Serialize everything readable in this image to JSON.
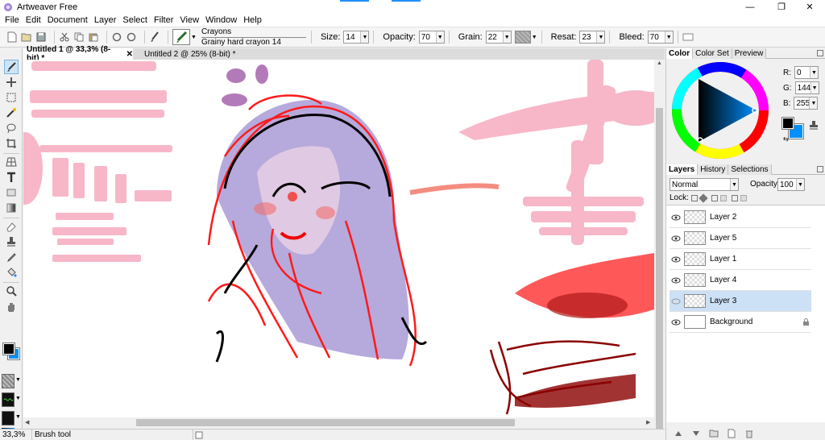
{
  "window": {
    "title": "Artweaver Free",
    "minimize": "—",
    "restore": "❐",
    "close": "✕"
  },
  "menu": [
    "File",
    "Edit",
    "Document",
    "Layer",
    "Select",
    "Filter",
    "View",
    "Window",
    "Help"
  ],
  "toolbar": {
    "brush_category": "Crayons",
    "brush_name": "Grainy hard crayon 14",
    "size_label": "Size:",
    "size_value": "14",
    "opacity_label": "Opacity:",
    "opacity_value": "70",
    "grain_label": "Grain:",
    "grain_value": "22",
    "resat_label": "Resat:",
    "resat_value": "23",
    "bleed_label": "Bleed:",
    "bleed_value": "70"
  },
  "documents": [
    {
      "label": "Untitled 1 @ 33,3% (8-bit) *",
      "active": true
    },
    {
      "label": "Untitled 2 @ 25% (8-bit) *",
      "active": false
    }
  ],
  "doc_close": "✕",
  "tools": [
    "brush-icon",
    "clone-icon",
    "rectangle-select-icon",
    "magic-wand-icon",
    "lasso-icon",
    "crop-icon",
    "perspective-icon",
    "text-icon",
    "shape-icon",
    "gradient-icon",
    "eraser-icon",
    "stamp-icon",
    "eyedropper-icon",
    "bucket-icon",
    "zoom-icon",
    "hand-icon"
  ],
  "colors": {
    "foreground": "#000000",
    "background": "#0090ff",
    "accent": "#1e90ff",
    "selection": "#cce0f6"
  },
  "color_panel": {
    "tabs": [
      "Color",
      "Color Set",
      "Preview"
    ],
    "r_label": "R:",
    "r_value": "0",
    "g_label": "G:",
    "g_value": "144",
    "b_label": "B:",
    "b_value": "255"
  },
  "layers_panel": {
    "tabs": [
      "Layers",
      "History",
      "Selections"
    ],
    "blend_mode": "Normal",
    "opacity_label": "Opacity:",
    "opacity_value": "100",
    "lock_label": "Lock:",
    "layers": [
      {
        "name": "Layer 2",
        "visible": true,
        "selected": false
      },
      {
        "name": "Layer 5",
        "visible": true,
        "selected": false
      },
      {
        "name": "Layer 1",
        "visible": true,
        "selected": false
      },
      {
        "name": "Layer 4",
        "visible": true,
        "selected": false
      },
      {
        "name": "Layer 3",
        "visible": false,
        "selected": true
      },
      {
        "name": "Background",
        "visible": true,
        "selected": false
      }
    ]
  },
  "status": {
    "zoom": "33,3%",
    "tool": "Brush tool"
  }
}
